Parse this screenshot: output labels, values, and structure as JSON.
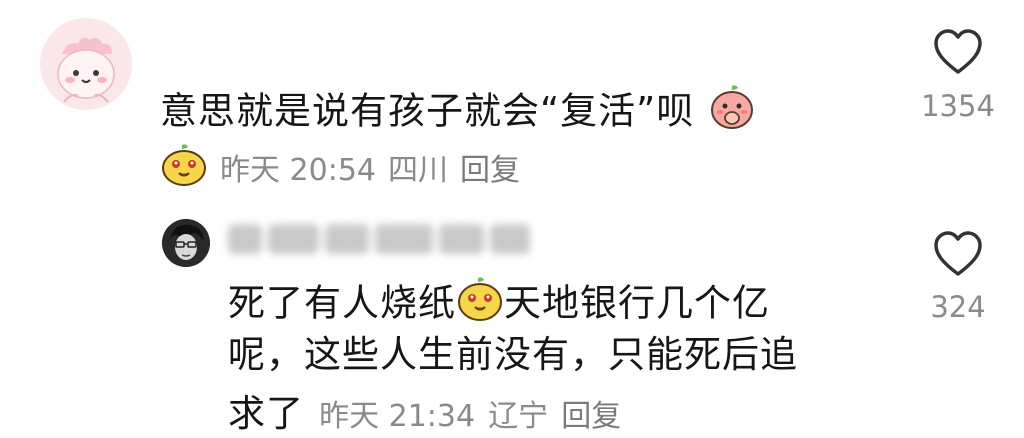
{
  "comments": [
    {
      "text_before_emoji": "意思就是说有孩子就会“复活”呗",
      "time": "昨天 20:54",
      "location": "四川",
      "reply_label": "回复",
      "like_count": "1354",
      "emoji_inline": "peach-cover-mouth-emoji",
      "emoji_meta": "yellow-smile-emoji"
    },
    {
      "author_masked": "",
      "text_line1_before_emoji": "死了有人烧纸",
      "text_line1_after_emoji": "天地银行几个亿",
      "text_line2": "呢，这些人生前没有，只能死后追",
      "text_line3_start": "求了",
      "time": "昨天 21:34",
      "location": "辽宁",
      "reply_label": "回复",
      "like_count": "324",
      "emoji_inline": "yellow-smile-emoji"
    }
  ],
  "icons": {
    "heart": "heart-outline-icon"
  },
  "colors": {
    "text": "#161616",
    "meta": "#8a8a8a",
    "avatar1_bg": "#fbe6ea"
  }
}
